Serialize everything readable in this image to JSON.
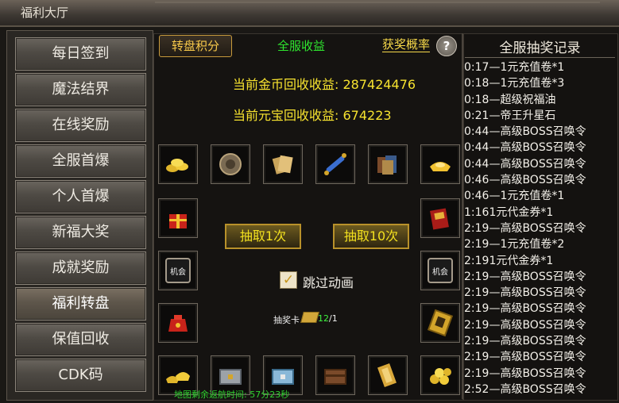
{
  "window": {
    "title": "福利大厅"
  },
  "sidebar": {
    "items": [
      {
        "label": "每日签到"
      },
      {
        "label": "魔法结界"
      },
      {
        "label": "在线奖励"
      },
      {
        "label": "全服首爆"
      },
      {
        "label": "个人首爆"
      },
      {
        "label": "新福大奖"
      },
      {
        "label": "成就奖励"
      },
      {
        "label": "福利转盘",
        "active": true
      },
      {
        "label": "保值回收"
      },
      {
        "label": "CDK码"
      }
    ]
  },
  "header": {
    "points_button": "转盘积分",
    "server_income": "全服收益",
    "prize_rate": "获奖概率",
    "help": "?"
  },
  "income": {
    "gold_line": "当前金币回收收益: 287424476",
    "yuanbao_line": "当前元宝回收收益: 674223"
  },
  "slots": [
    {
      "icon": "gold-coins-icon"
    },
    {
      "icon": "medallion-icon"
    },
    {
      "icon": "scroll-bundle-icon"
    },
    {
      "icon": "blue-scroll-icon"
    },
    {
      "icon": "book-set-icon"
    },
    {
      "icon": "gold-ingot-icon"
    },
    {
      "icon": "red-gift-box-icon"
    },
    {
      "icon": "red-book-icon"
    },
    {
      "icon": "chance-icon",
      "text": "机会"
    },
    {
      "icon": "chance-icon",
      "text": "机会"
    },
    {
      "icon": "red-pouch-icon"
    },
    {
      "icon": "gold-treasure-card-icon"
    },
    {
      "icon": "gold-ingots-icon"
    },
    {
      "icon": "silver-chest-icon"
    },
    {
      "icon": "blue-chest-icon"
    },
    {
      "icon": "wooden-chest-icon"
    },
    {
      "icon": "gold-scroll-icon"
    },
    {
      "icon": "coin-pile-icon"
    }
  ],
  "draw": {
    "once": "抽取1次",
    "ten": "抽取10次",
    "skip_animation": "跳过动画",
    "skip_checked": true,
    "card_label": "抽奖卡",
    "card_current": "12",
    "card_total": "/1"
  },
  "footer": {
    "nav_time": "地图剩余返航时间: 57分23秒"
  },
  "records": {
    "title": "全服抽奖记录",
    "items": [
      "0:17—1元充值卷*1",
      "0:18—1元充值卷*3",
      "0:18—超级祝福油",
      "0:21—帝王升星石",
      "0:44—高级BOSS召唤令",
      "0:44—高级BOSS召唤令",
      "0:44—高级BOSS召唤令",
      "0:46—高级BOSS召唤令",
      "0:46—1元充值卷*1",
      "1:161元代金券*1",
      "2:19—高级BOSS召唤令",
      "2:19—1元充值卷*2",
      "2:191元代金券*1",
      "2:19—高级BOSS召唤令",
      "2:19—高级BOSS召唤令",
      "2:19—高级BOSS召唤令",
      "2:19—高级BOSS召唤令",
      "2:19—高级BOSS召唤令",
      "2:19—高级BOSS召唤令",
      "2:19—高级BOSS召唤令",
      "2:52—高级BOSS召唤令"
    ]
  }
}
